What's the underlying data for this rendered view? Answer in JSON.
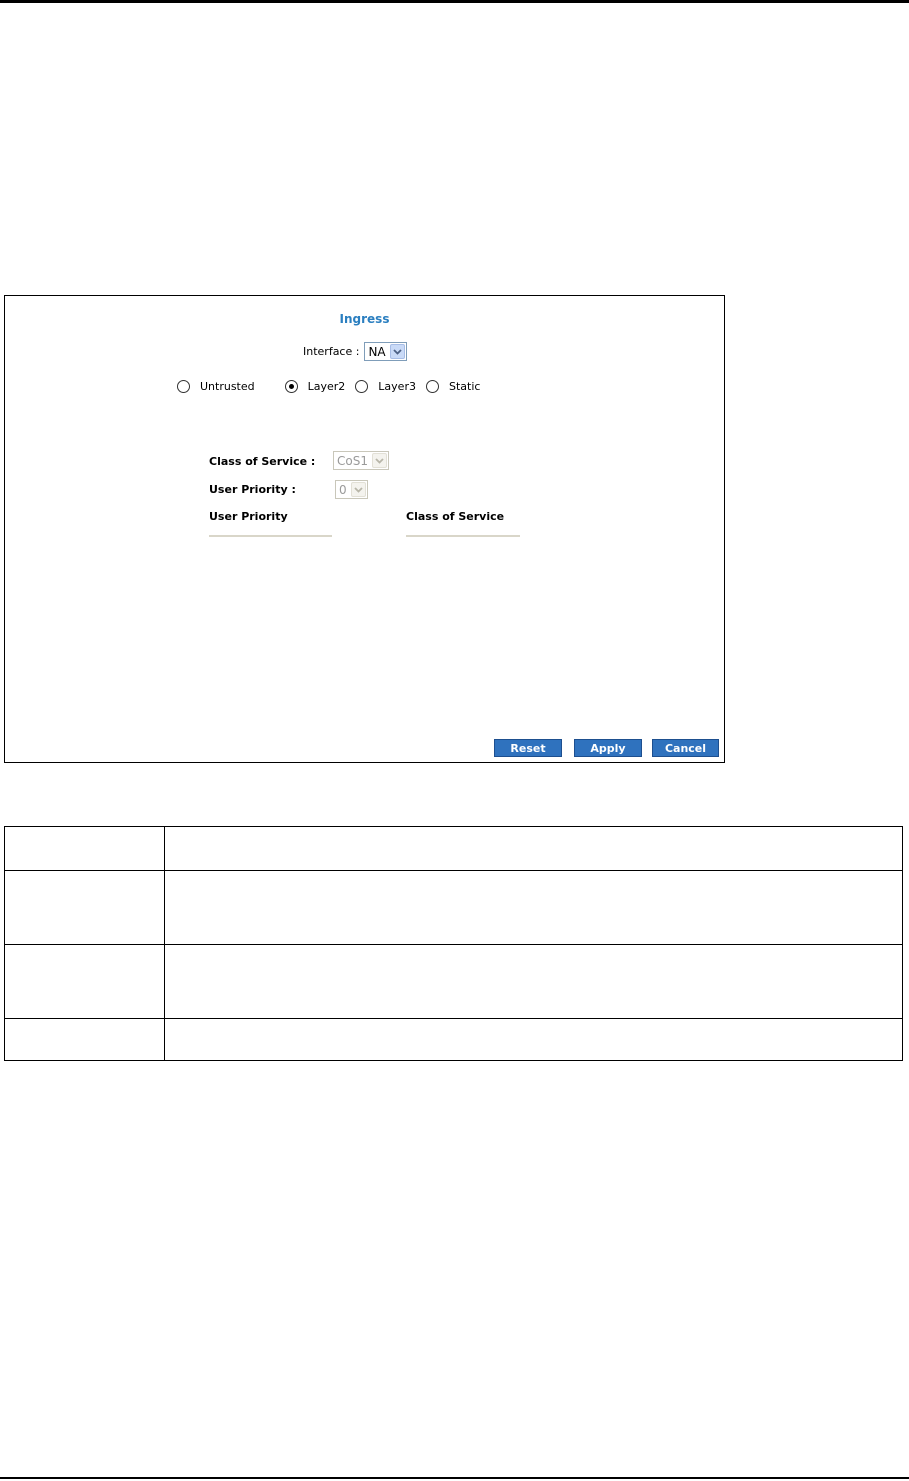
{
  "window": {
    "title": "Ingress"
  },
  "interface": {
    "label": "Interface :",
    "selected": "NA"
  },
  "trust_modes": [
    {
      "label": "Untrusted",
      "checked": false
    },
    {
      "label": "Layer2",
      "checked": true
    },
    {
      "label": "Layer3",
      "checked": false
    },
    {
      "label": "Static",
      "checked": false
    }
  ],
  "form": {
    "cos_label": "Class of Service :",
    "cos_value": "CoS1",
    "priority_label": "User Priority :",
    "priority_value": "0"
  },
  "mapping_table": {
    "columns": [
      "User Priority",
      "Class of Service"
    ]
  },
  "buttons": {
    "reset": "Reset",
    "apply": "Apply",
    "cancel": "Cancel"
  },
  "colors": {
    "title": "#2b7fc0",
    "button": "#2f72be"
  }
}
